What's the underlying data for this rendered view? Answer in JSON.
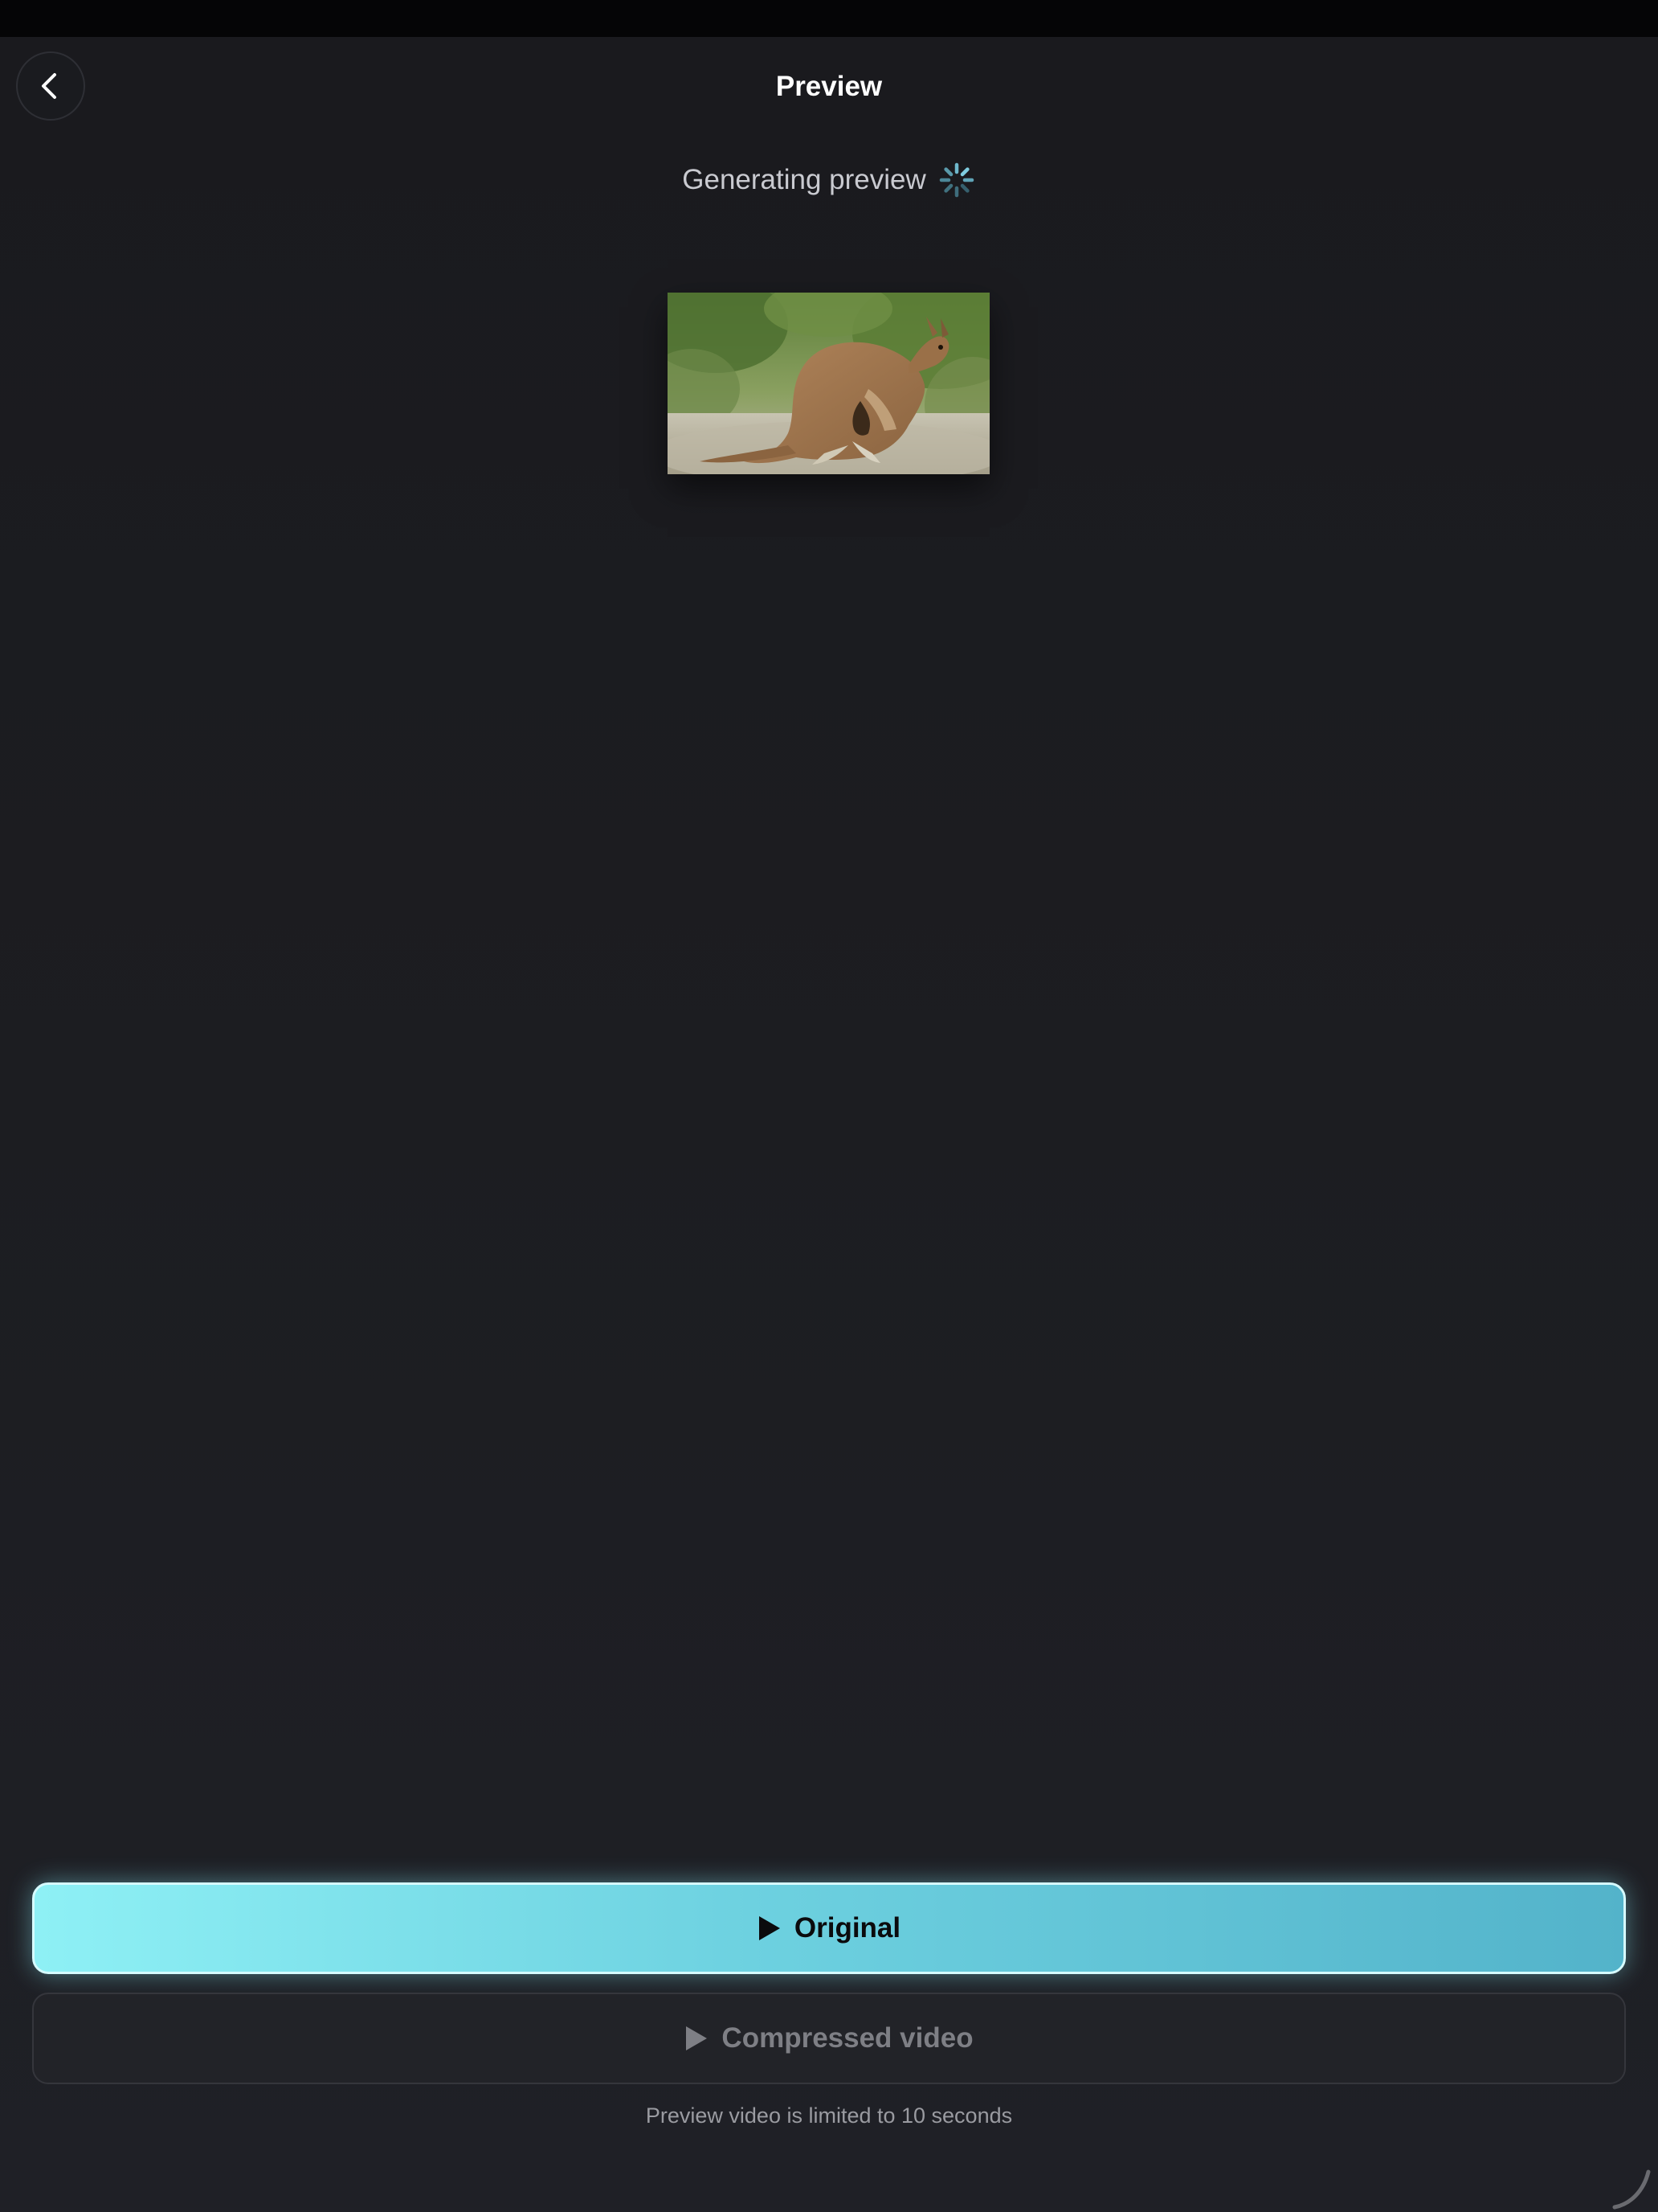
{
  "header": {
    "title": "Preview",
    "back_icon": "chevron-left-icon"
  },
  "status": {
    "generating_label": "Generating preview",
    "spinner_icon": "spinner-icon"
  },
  "thumbnail": {
    "description_icon": "video-thumbnail"
  },
  "buttons": {
    "original_label": "Original",
    "compressed_label": "Compressed video",
    "play_icon": "play-icon"
  },
  "footer": {
    "note": "Preview video is limited to 10 seconds"
  },
  "colors": {
    "accent_start": "#8ef0f5",
    "accent_end": "#53b3ca",
    "background": "#1c1d21"
  }
}
